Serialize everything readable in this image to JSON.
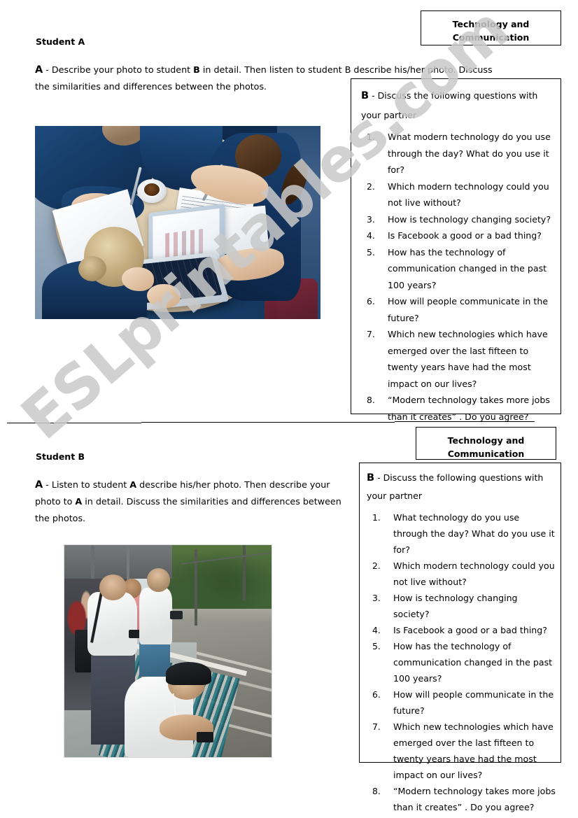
{
  "document": {
    "type": "esl-worksheet",
    "watermark": "ESLprintables.com"
  },
  "title_box": {
    "line1": "Technology and",
    "line2": "Communication"
  },
  "section_a": {
    "student_label": "Student A",
    "instruction_lead": "A",
    "instruction_text": " - Describe your photo to student B in detail. Then listen to student B describe his/her photo. Discuss the similarities and differences between the photos.",
    "instruction_parts": {
      "p1": " - Describe your photo to student ",
      "b_bold": "B",
      "p2": " in detail. Then listen to student B describe his/her photo. Discuss the similarities and differences between the photos."
    },
    "photo_alt": "Three students in dark blue blazers around a table with a laptop, papers and a cup of coffee, seen from above",
    "questions_box": {
      "lead": "B",
      "intro": " - Discuss the following questions with your partner",
      "questions": [
        "What modern technology do you use through the day? What do you use it for?",
        "Which modern technology could you not live without?",
        "How is technology changing society?",
        "Is Facebook a good or a bad thing?",
        "How has the technology of communication changed in the past 100 years?",
        "How will people communicate in the future?",
        "Which new technologies which have emerged over the last fifteen to twenty years have had the most impact on our lives?",
        "“Modern technology takes more jobs than it creates” . Do you agree?"
      ]
    }
  },
  "section_b": {
    "student_label": "Student B",
    "instruction_lead": "A",
    "instruction_parts": {
      "p1": " - Listen to student ",
      "a_bold": "A",
      "p2": " describe his/her photo. Then describe your photo to ",
      "a_bold2": "A",
      "p3": " in detail. Discuss the similarities and differences between the photos."
    },
    "photo_alt": "People waiting on a train station platform, several looking at mobile phones, one man crouching at the platform edge",
    "questions_box": {
      "lead": "B",
      "intro": " - Discuss the following questions with your partner",
      "questions": [
        "What technology do you use through the day? What do you use it for?",
        "Which modern technology could you not live without?",
        "How is technology changing society?",
        "Is Facebook a good or a bad thing?",
        "How has the technology of communication changed in the past 100 years?",
        "How will people communicate in the future?",
        "Which new technologies which have emerged over the last fifteen to twenty years have had the most impact on our lives?",
        "“Modern technology takes more jobs than it creates” . Do you agree?"
      ]
    }
  },
  "colors": {
    "text": "#000000",
    "border": "#000000",
    "page_background": "#ffffff",
    "watermark": "#c9c9c9"
  }
}
